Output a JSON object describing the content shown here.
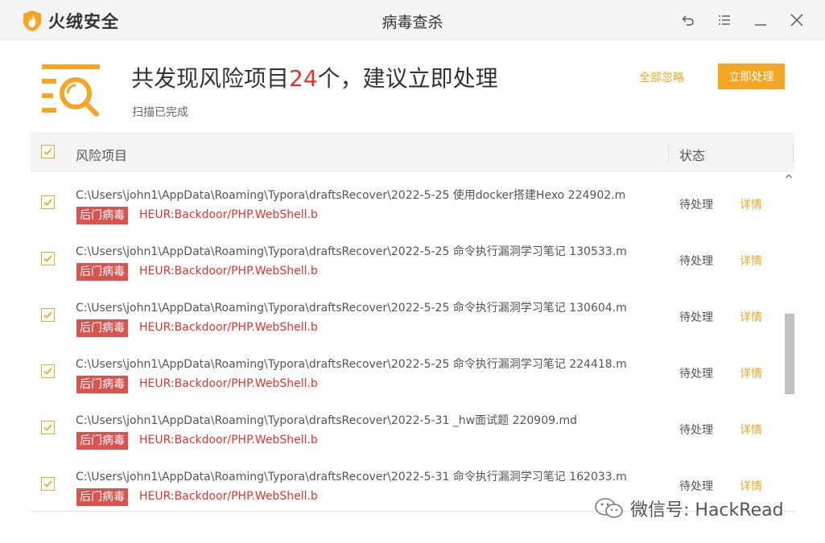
{
  "window": {
    "app_name": "火绒安全",
    "title": "病毒查杀"
  },
  "summary": {
    "headline_prefix": "共发现风险项目",
    "risk_count": "24",
    "headline_suffix": "个，建议立即处理",
    "status": "扫描已完成",
    "ignore_all_label": "全部忽略",
    "fix_now_label": "立即处理"
  },
  "table": {
    "col_name": "风险项目",
    "col_status": "状态",
    "rows": [
      {
        "path": "C:\\Users\\john1\\AppData\\Roaming\\Typora\\draftsRecover\\2022-5-25 使用docker搭建Hexo 224902.m",
        "tag": "后门病毒",
        "virus": "HEUR:Backdoor/PHP.WebShell.b",
        "status": "待处理",
        "detail": "详情"
      },
      {
        "path": "C:\\Users\\john1\\AppData\\Roaming\\Typora\\draftsRecover\\2022-5-25 命令执行漏洞学习笔记 130533.m",
        "tag": "后门病毒",
        "virus": "HEUR:Backdoor/PHP.WebShell.b",
        "status": "待处理",
        "detail": "详情"
      },
      {
        "path": "C:\\Users\\john1\\AppData\\Roaming\\Typora\\draftsRecover\\2022-5-25 命令执行漏洞学习笔记 130604.m",
        "tag": "后门病毒",
        "virus": "HEUR:Backdoor/PHP.WebShell.b",
        "status": "待处理",
        "detail": "详情"
      },
      {
        "path": "C:\\Users\\john1\\AppData\\Roaming\\Typora\\draftsRecover\\2022-5-25 命令执行漏洞学习笔记 224418.m",
        "tag": "后门病毒",
        "virus": "HEUR:Backdoor/PHP.WebShell.b",
        "status": "待处理",
        "detail": "详情"
      },
      {
        "path": "C:\\Users\\john1\\AppData\\Roaming\\Typora\\draftsRecover\\2022-5-31 _hw面试题 220909.md",
        "tag": "后门病毒",
        "virus": "HEUR:Backdoor/PHP.WebShell.b",
        "status": "待处理",
        "detail": "详情"
      },
      {
        "path": "C:\\Users\\john1\\AppData\\Roaming\\Typora\\draftsRecover\\2022-5-31 命令执行漏洞学习笔记 162033.m",
        "tag": "后门病毒",
        "virus": "HEUR:Backdoor/PHP.WebShell.b",
        "status": "待处理",
        "detail": "详情"
      }
    ]
  },
  "watermark": {
    "text": "微信号: HackRead"
  },
  "colors": {
    "accent": "#f5a623",
    "danger": "#e5332a",
    "tag_bg": "#d9534f"
  },
  "icons": [
    "huorong-logo-icon",
    "back-icon",
    "menu-icon",
    "minimize-icon",
    "close-icon",
    "scan-search-icon",
    "checkbox-checked-icon",
    "scroll-up-icon",
    "wechat-icon"
  ]
}
